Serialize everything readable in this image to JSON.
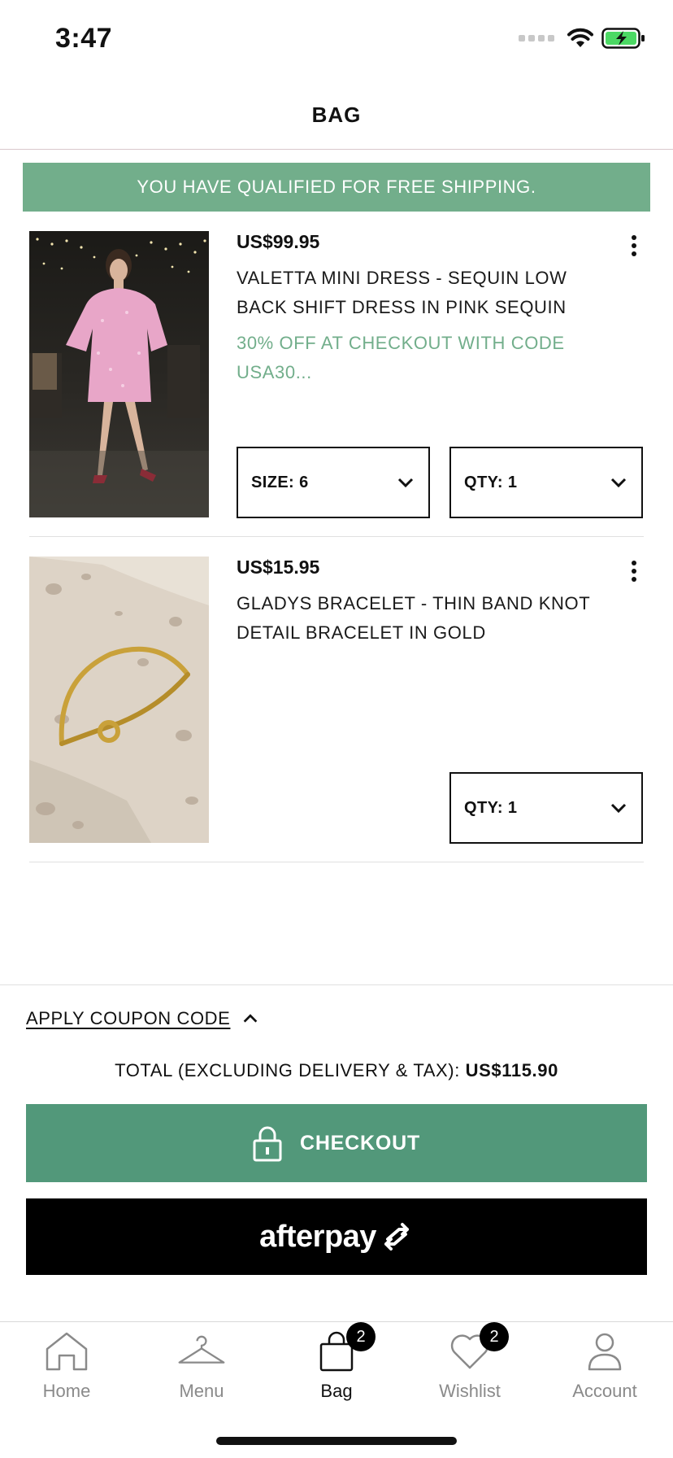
{
  "status_bar": {
    "time": "3:47"
  },
  "header": {
    "title": "BAG"
  },
  "banner": {
    "text": "YOU HAVE QUALIFIED FOR FREE SHIPPING."
  },
  "items": [
    {
      "price": "US$99.95",
      "name": "VALETTA MINI DRESS - SEQUIN LOW BACK SHIFT DRESS IN PINK SEQUIN",
      "promo": "30% OFF AT CHECKOUT WITH CODE USA30...",
      "size_label": "SIZE: 6",
      "qty_label": "QTY: 1"
    },
    {
      "price": "US$15.95",
      "name": "GLADYS BRACELET - THIN BAND KNOT DETAIL BRACELET IN GOLD",
      "qty_label": "QTY: 1"
    }
  ],
  "coupon": {
    "label": "APPLY COUPON CODE"
  },
  "total": {
    "label": "TOTAL (EXCLUDING DELIVERY & TAX): ",
    "value": "US$115.90"
  },
  "checkout": {
    "label": "CHECKOUT"
  },
  "afterpay": {
    "label": "afterpay"
  },
  "tab_bar": {
    "tabs": [
      {
        "label": "Home",
        "icon": "home-icon"
      },
      {
        "label": "Menu",
        "icon": "hanger-icon"
      },
      {
        "label": "Bag",
        "icon": "bag-icon",
        "badge": "2",
        "active": true
      },
      {
        "label": "Wishlist",
        "icon": "heart-icon",
        "badge": "2"
      },
      {
        "label": "Account",
        "icon": "person-icon"
      }
    ]
  },
  "colors": {
    "accent_green": "#72ae8b",
    "checkout_green": "#52987a"
  }
}
